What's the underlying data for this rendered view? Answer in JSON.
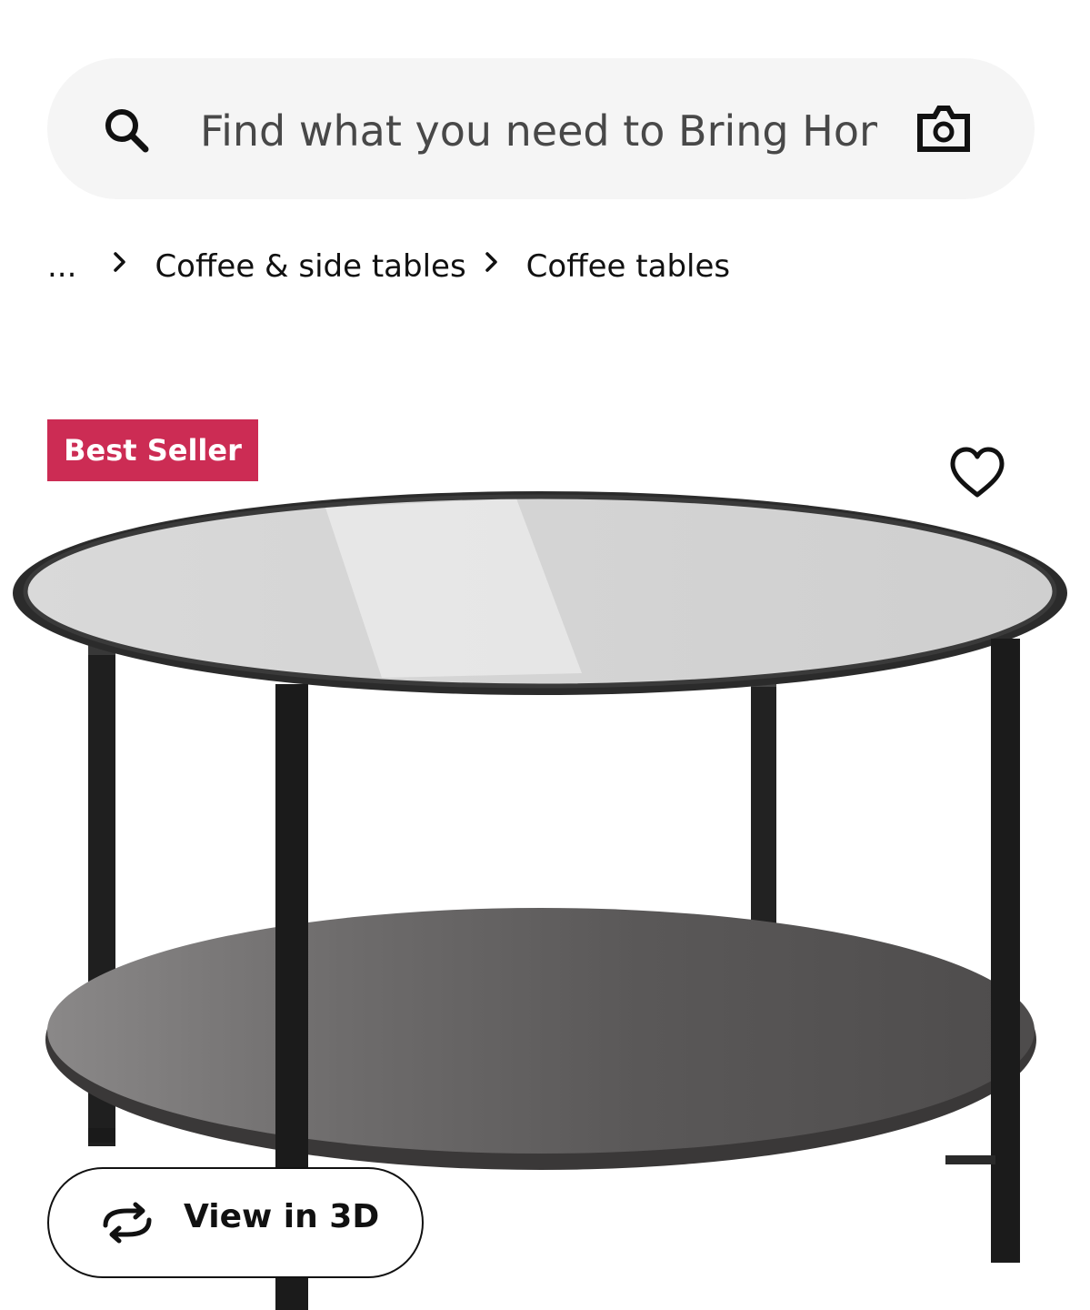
{
  "search": {
    "placeholder": "Find what you need to Bring Home",
    "search_icon": "search-icon",
    "camera_icon": "camera-icon"
  },
  "breadcrumb": {
    "ellipsis": "...",
    "items": [
      {
        "label": "Coffee & side tables"
      },
      {
        "label": "Coffee tables"
      }
    ],
    "separator_icon": "chevron-right-icon"
  },
  "product": {
    "badge": "Best Seller",
    "badge_color": "#cc2c54",
    "favorite_icon": "heart-icon",
    "view3d_label": "View in 3D",
    "view3d_icon": "rotate-icon"
  }
}
